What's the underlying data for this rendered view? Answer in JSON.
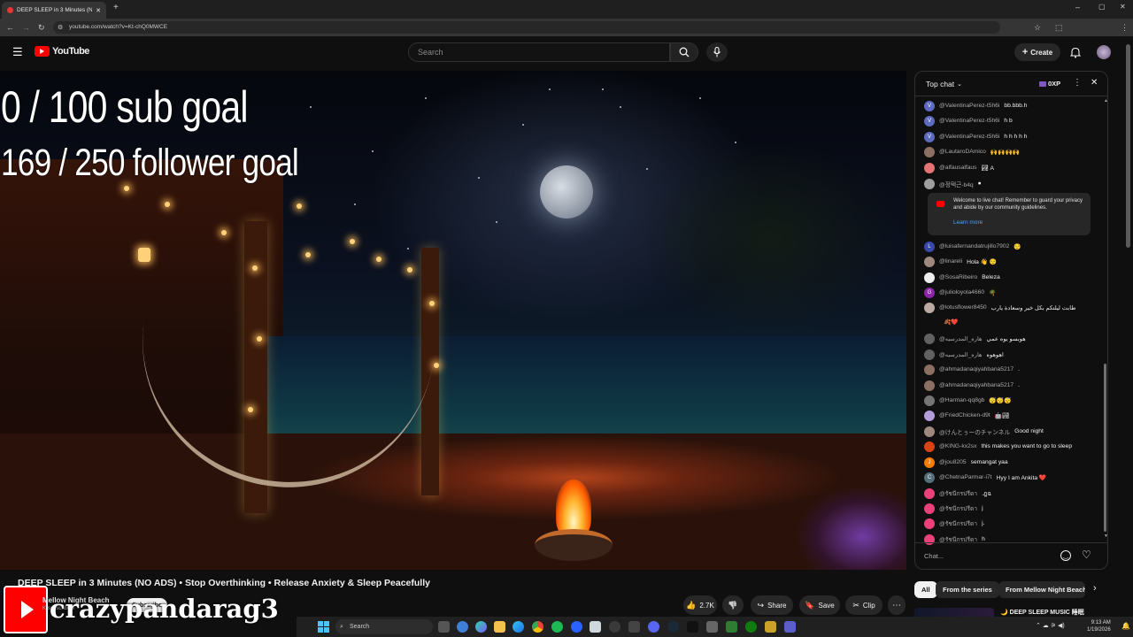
{
  "browser": {
    "tab_title": "DEEP SLEEP in 3 Minutes (NO A",
    "tab_close": "✕",
    "new_tab": "+",
    "url": "youtube.com/watch?v=Kt-chQ0MWCE"
  },
  "header": {
    "logo_text": "YouTube",
    "search_placeholder": "Search",
    "create_label": "Create"
  },
  "video": {
    "overlay_goal_sub": "0 / 100 sub goal",
    "overlay_goal_follower": "169 / 250 follower goal",
    "title": "DEEP SLEEP in 3 Minutes (NO ADS) • Stop Overthinking • Release Anxiety & Sleep Peacefully",
    "channel_name": "Mellow Night Beach",
    "channel_subs": "K subscribers",
    "subscribe_label": "Subscribe",
    "overlay_username": "crazypandarag3",
    "likes": "2.7K",
    "share_label": "Share",
    "save_label": "Save",
    "clip_label": "Clip",
    "more_label": "⋯"
  },
  "chat": {
    "header_title": "Top chat",
    "xp_label": "0XP",
    "input_placeholder": "Chat...",
    "welcome_text": "Welcome to live chat! Remember to guard your privacy and abide by our community guidelines.",
    "learn_more": "Learn more",
    "messages": [
      {
        "author": "@ValentinaPerez-t5h6i",
        "text": "bb.bbb.h",
        "avatar": "V",
        "color": "#5c6bc0"
      },
      {
        "author": "@ValentinaPerez-t5h6i",
        "text": "h b",
        "avatar": "V",
        "color": "#5c6bc0"
      },
      {
        "author": "@ValentinaPerez-t5h6i",
        "text": "h h h h h",
        "avatar": "V",
        "color": "#5c6bc0"
      },
      {
        "author": "@LautaroDAmico",
        "text": "🙌🙌🙌🙌",
        "avatar": "",
        "color": "#8d6e63"
      },
      {
        "author": "@alfausalfaus",
        "text": "🏞 A",
        "avatar": "",
        "color": "#e57373"
      },
      {
        "author": "@정택근-b4q",
        "text": "●",
        "avatar": "",
        "color": "#9e9e9e"
      },
      {
        "author": "@luisafernandatrujillo7902",
        "text": "😌",
        "avatar": "L",
        "color": "#3949ab"
      },
      {
        "author": "@linareli",
        "text": "Hola 👋 😌",
        "avatar": "",
        "color": "#a1887f"
      },
      {
        "author": "@SosaRibeiro",
        "text": "Beleza",
        "avatar": "",
        "color": "#eeeeee"
      },
      {
        "author": "@julioloyola4660",
        "text": "🌴",
        "avatar": "G",
        "color": "#8e24aa"
      },
      {
        "author": "@lotusflower8450",
        "text": "طابت ليلتكم بكل خير وسعادة يارب",
        "avatar": "",
        "color": "#bcaaa4"
      },
      {
        "author": "",
        "text": "🍂❤️",
        "avatar": "",
        "color": "transparent"
      },
      {
        "author": "@هاره_المدرسيه",
        "text": "هوبسو يوه عمي",
        "avatar": "",
        "color": "#616161"
      },
      {
        "author": "@هاره_المدرسيه",
        "text": "اهوهوه",
        "avatar": "",
        "color": "#616161"
      },
      {
        "author": "@ahmadanaqiyahbana5217",
        "text": ".",
        "avatar": "",
        "color": "#8d6e63"
      },
      {
        "author": "@ahmadanaqiyahbana5217",
        "text": ".",
        "avatar": "",
        "color": "#8d6e63"
      },
      {
        "author": "@Harman-qq8gb",
        "text": "😴😴😴",
        "avatar": "",
        "color": "#757575"
      },
      {
        "author": "@FriedChicken-d9t",
        "text": "🤖🏞",
        "avatar": "",
        "color": "#b39ddb"
      },
      {
        "author": "@けんとぅーのチャンネル",
        "text": "Good night",
        "avatar": "",
        "color": "#a1887f"
      },
      {
        "author": "@KING-kx2sx",
        "text": "this makes you want to go to sleep",
        "avatar": "",
        "color": "#d84315"
      },
      {
        "author": "@jou8205",
        "text": "semangat yaa",
        "avatar": "J",
        "color": "#f57c00"
      },
      {
        "author": "@ChetnaParmar-i7t",
        "text": "Hyy I am Ankita ❤️",
        "avatar": "C",
        "color": "#546e7a"
      },
      {
        "author": "@รัชนีกรปรีดา",
        "text": ".ฎฉ",
        "avatar": "",
        "color": "#ec407a"
      },
      {
        "author": "@รัชนีกรปรีดา",
        "text": "j",
        "avatar": "",
        "color": "#ec407a"
      },
      {
        "author": "@รัชนีกรปรีดา",
        "text": "j.",
        "avatar": "",
        "color": "#ec407a"
      },
      {
        "author": "@รัชนีกรปรีดา",
        "text": "h",
        "avatar": "",
        "color": "#ec407a"
      }
    ]
  },
  "chips": {
    "all": "All",
    "series": "From the series",
    "channel": "From Mellow Night Beach"
  },
  "recommendation": {
    "title": "🌙 DEEP SLEEP MUSIC 睡眠"
  },
  "taskbar": {
    "search": "Search",
    "time": "9:13 AM",
    "date": "1/19/2026"
  }
}
